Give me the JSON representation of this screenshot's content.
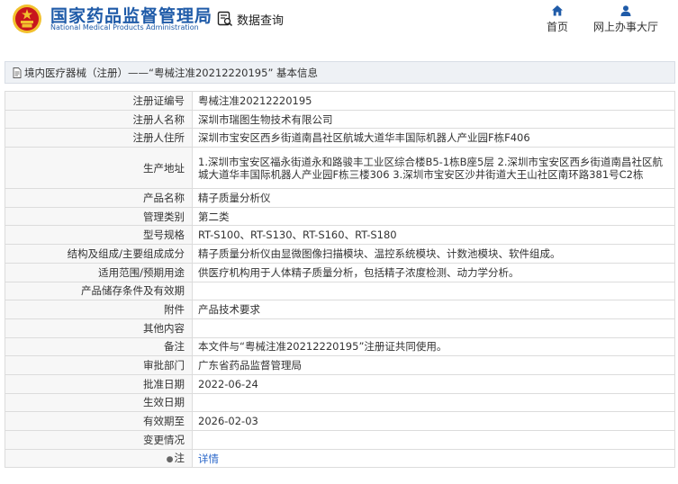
{
  "header": {
    "logo_cn": "国家药品监督管理局",
    "logo_en": "National Medical Products Administration",
    "query_label": "数据查询",
    "nav": [
      {
        "label": "首页",
        "icon": "home-icon"
      },
      {
        "label": "网上办事大厅",
        "icon": "user-icon"
      }
    ]
  },
  "title_bar": {
    "text": "境内医疗器械（注册）——“粤械注准20212220195” 基本信息"
  },
  "rows": [
    {
      "label": "注册证编号",
      "value": "粤械注准20212220195"
    },
    {
      "label": "注册人名称",
      "value": "深圳市瑞图生物技术有限公司"
    },
    {
      "label": "注册人住所",
      "value": "深圳市宝安区西乡街道南昌社区航城大道华丰国际机器人产业园F栋F406"
    },
    {
      "label": "生产地址",
      "value": "1.深圳市宝安区福永街道永和路骏丰工业区综合楼B5-1栋B座5层 2.深圳市宝安区西乡街道南昌社区航城大道华丰国际机器人产业园F栋三楼306 3.深圳市宝安区沙井街道大王山社区南环路381号C2栋"
    },
    {
      "label": "产品名称",
      "value": "精子质量分析仪"
    },
    {
      "label": "管理类别",
      "value": "第二类"
    },
    {
      "label": "型号规格",
      "value": "RT-S100、RT-S130、RT-S160、RT-S180"
    },
    {
      "label": "结构及组成/主要组成成分",
      "value": "精子质量分析仪由显微图像扫描模块、温控系统模块、计数池模块、软件组成。"
    },
    {
      "label": "适用范围/预期用途",
      "value": "供医疗机构用于人体精子质量分析，包括精子浓度检测、动力学分析。"
    },
    {
      "label": "产品储存条件及有效期",
      "value": ""
    },
    {
      "label": "附件",
      "value": "产品技术要求"
    },
    {
      "label": "其他内容",
      "value": ""
    },
    {
      "label": "备注",
      "value": "本文件与“粤械注准20212220195”注册证共同使用。"
    },
    {
      "label": "审批部门",
      "value": "广东省药品监督管理局"
    },
    {
      "label": "批准日期",
      "value": "2022-06-24"
    },
    {
      "label": "生效日期",
      "value": ""
    },
    {
      "label": "有效期至",
      "value": "2026-02-03"
    },
    {
      "label": "变更情况",
      "value": ""
    },
    {
      "label": "注",
      "value": "详情",
      "icon": "lightbulb-icon"
    }
  ],
  "colors": {
    "brand_blue": "#1f5ba8",
    "link_blue": "#2a67c9",
    "emblem_red": "#c8161d",
    "emblem_gold": "#f2c12e"
  }
}
